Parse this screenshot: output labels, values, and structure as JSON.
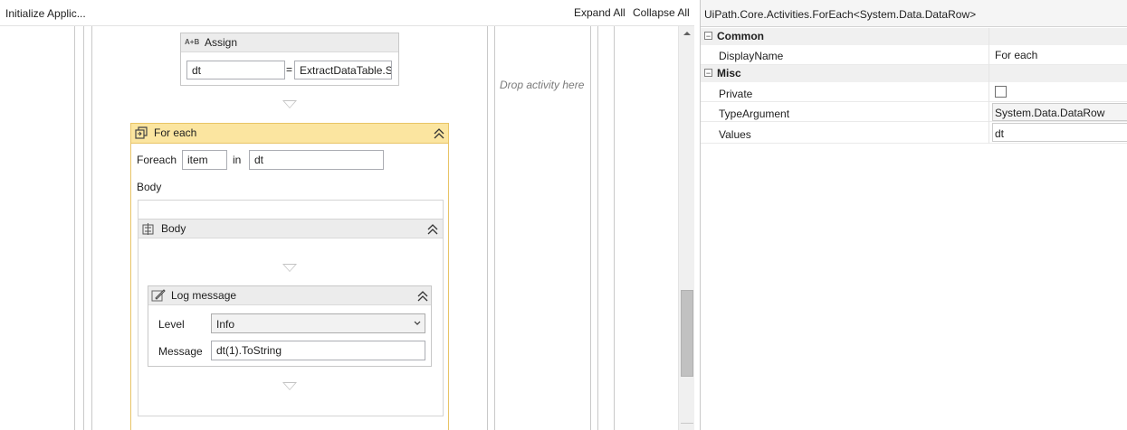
{
  "designer": {
    "breadcrumb": "Initialize Applic...",
    "expand_all": "Expand All",
    "collapse_all": "Collapse All",
    "drop_hint": "Drop activity here",
    "assign": {
      "title": "Assign",
      "icon_text": "A+B",
      "to": "dt",
      "value": "ExtractDataTable.S"
    },
    "foreach": {
      "title": "For each",
      "foreach_label": "Foreach",
      "item": "item",
      "in_label": "in",
      "values": "dt",
      "body_label": "Body",
      "body_sequence": {
        "title": "Body",
        "log_message": {
          "title": "Log message",
          "level_label": "Level",
          "level_value": "Info",
          "message_label": "Message",
          "message_value": "dt(1).ToString"
        }
      }
    }
  },
  "properties": {
    "title": "UiPath.Core.Activities.ForEach<System.Data.DataRow>",
    "categories": [
      {
        "name": "Common",
        "rows": [
          {
            "name": "DisplayName",
            "value": "For each"
          }
        ]
      },
      {
        "name": "Misc",
        "rows": [
          {
            "name": "Private",
            "value": ""
          },
          {
            "name": "TypeArgument",
            "value": "System.Data.DataRow"
          },
          {
            "name": "Values",
            "value": "dt"
          }
        ]
      }
    ],
    "private_checked": false
  }
}
